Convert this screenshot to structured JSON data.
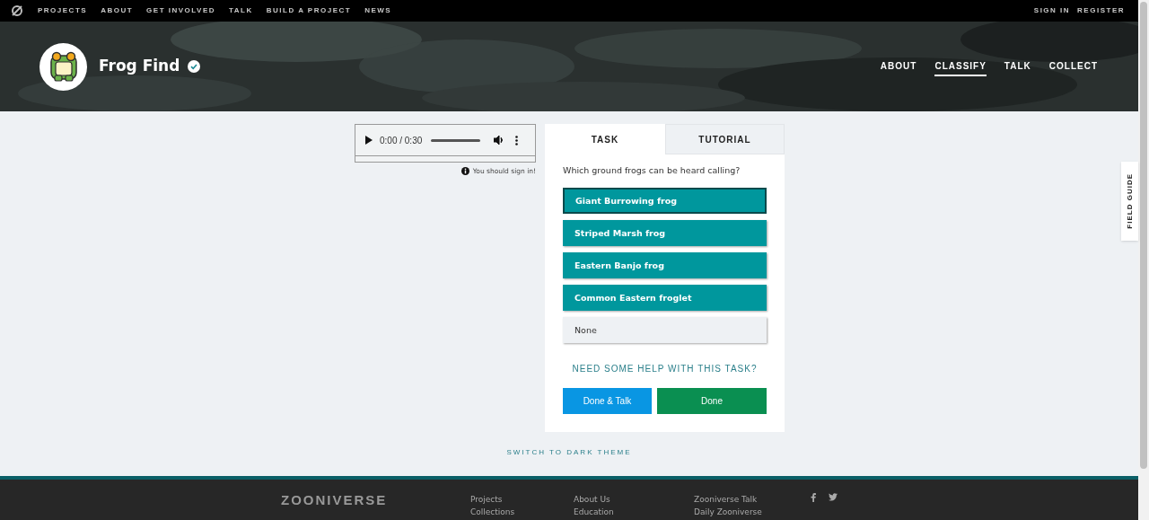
{
  "top_nav": {
    "links": [
      "PROJECTS",
      "ABOUT",
      "GET INVOLVED",
      "TALK",
      "BUILD A PROJECT",
      "NEWS"
    ],
    "account": [
      "SIGN IN",
      "REGISTER"
    ]
  },
  "project": {
    "title": "Frog Find",
    "verified": true,
    "nav": [
      {
        "label": "ABOUT",
        "selected": false
      },
      {
        "label": "CLASSIFY",
        "selected": true
      },
      {
        "label": "TALK",
        "selected": false
      },
      {
        "label": "COLLECT",
        "selected": false
      }
    ]
  },
  "audio": {
    "time": "0:00 / 0:30"
  },
  "sign_in_note": "You should sign in!",
  "tabs": [
    {
      "label": "TASK",
      "selected": true
    },
    {
      "label": "TUTORIAL",
      "selected": false
    }
  ],
  "question": "Which ground frogs can be heard calling?",
  "answers": [
    {
      "label": "Giant Burrowing frog",
      "kind": "species",
      "focused": true
    },
    {
      "label": "Striped Marsh frog",
      "kind": "species",
      "focused": false
    },
    {
      "label": "Eastern Banjo frog",
      "kind": "species",
      "focused": false
    },
    {
      "label": "Common Eastern froglet",
      "kind": "species",
      "focused": false
    },
    {
      "label": "None",
      "kind": "none",
      "focused": false
    }
  ],
  "help_link": "NEED SOME HELP WITH THIS TASK?",
  "buttons": [
    {
      "label": "Done & Talk",
      "kind": "talk"
    },
    {
      "label": "Done",
      "kind": "done"
    }
  ],
  "field_guide": "FIELD GUIDE",
  "theme_link": "SWITCH TO DARK THEME",
  "footer": {
    "logo": "ZOONIVERSE",
    "columns": [
      [
        "Projects",
        "Collections"
      ],
      [
        "About Us",
        "Education"
      ],
      [
        "Zooniverse Talk",
        "Daily Zooniverse"
      ]
    ]
  }
}
